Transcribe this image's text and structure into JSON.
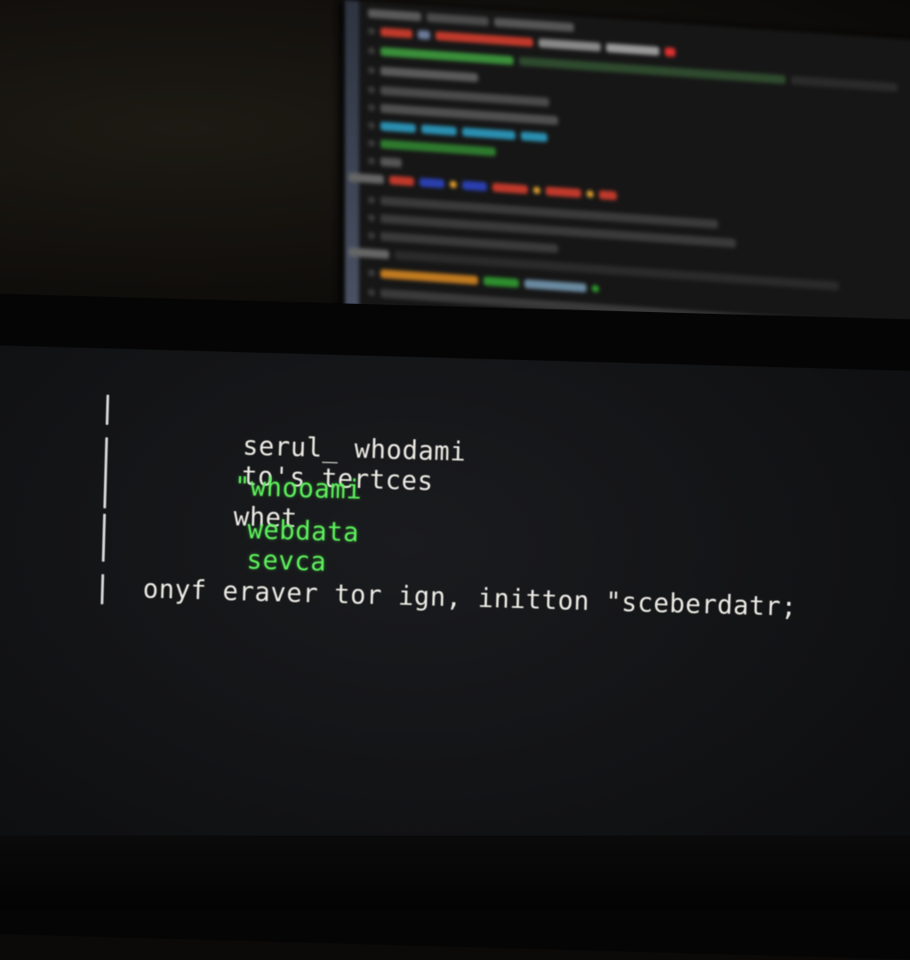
{
  "colors": {
    "terminal_background": "#121315",
    "text_primary": "#eceae4",
    "text_highlight": "#5cf05c"
  },
  "terminal": {
    "line1": {
      "part1": "serul_ whodami",
      "part2": "to's tertces"
    },
    "line2": {
      "part1": "\"whooami",
      "part2": "whet"
    },
    "line3": {
      "part1": "webdata",
      "part2": "sevca"
    },
    "line4": {
      "text": "onyf eraver tor ign, initton \"sceberdatr;"
    }
  }
}
